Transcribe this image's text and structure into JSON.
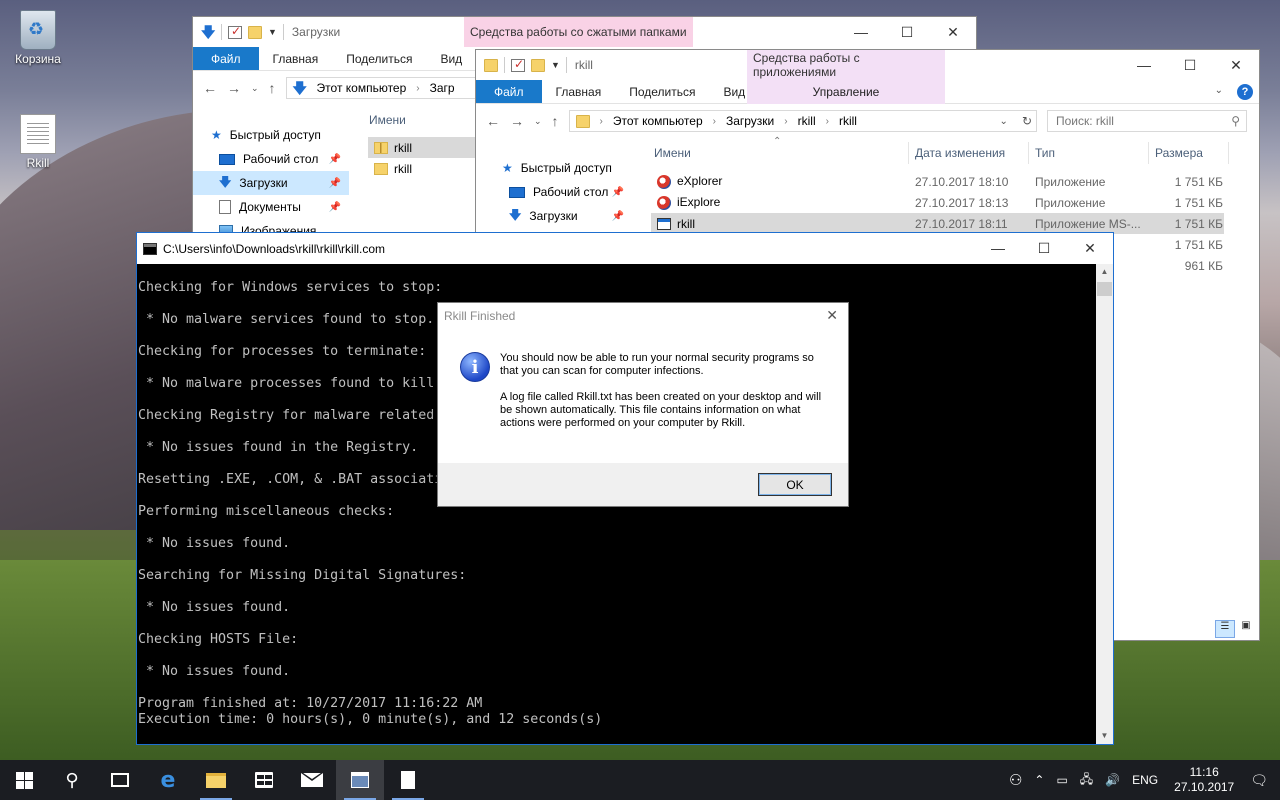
{
  "desktop": {
    "icons": [
      {
        "label": "Корзина",
        "icon": "recycle-bin-icon"
      },
      {
        "label": "Rkill",
        "icon": "text-file-icon"
      }
    ]
  },
  "explorer_back": {
    "title": "Загрузки",
    "context_tab": "Средства работы со сжатыми папками",
    "context_tab_color": "#f9d2e6",
    "tabs": [
      "Файл",
      "Главная",
      "Поделиться",
      "Вид"
    ],
    "path": [
      "Этот компьютер",
      "Загр"
    ],
    "nav": [
      "Быстрый доступ",
      "Рабочий стол",
      "Загрузки",
      "Документы",
      "Изображения"
    ],
    "column": "Имени",
    "files": [
      "rkill",
      "rkill"
    ]
  },
  "explorer_front": {
    "title": "rkill",
    "context_tab": "Средства работы с приложениями",
    "context_tab_color": "#f3e0f6",
    "context_sub": "Управление",
    "tabs": [
      "Файл",
      "Главная",
      "Поделиться",
      "Вид"
    ],
    "path": [
      "Этот компьютер",
      "Загрузки",
      "rkill",
      "rkill"
    ],
    "search_placeholder": "Поиск: rkill",
    "nav": [
      "Быстрый доступ",
      "Рабочий стол",
      "Загрузки"
    ],
    "columns": [
      "Имени",
      "Дата изменения",
      "Тип",
      "Размера"
    ],
    "files": [
      {
        "name": "eXplorer",
        "date": "27.10.2017 18:10",
        "type": "Приложение",
        "size": "1 751 КБ"
      },
      {
        "name": "iExplore",
        "date": "27.10.2017 18:13",
        "type": "Приложение",
        "size": "1 751 КБ"
      },
      {
        "name": "rkill",
        "date": "27.10.2017 18:11",
        "type": "Приложение MS-...",
        "size": "1 751 КБ"
      },
      {
        "name": "",
        "date": "",
        "type": "",
        "size": "1 751 КБ"
      },
      {
        "name": "",
        "date": "",
        "type": "MS-...",
        "size": "961 КБ"
      }
    ]
  },
  "console": {
    "title": "C:\\Users\\info\\Downloads\\rkill\\rkill\\rkill.com",
    "lines": [
      "Checking for Windows services to stop:",
      "",
      " * No malware services found to stop.",
      "",
      "Checking for processes to terminate:",
      "",
      " * No malware processes found to kill.",
      "",
      "Checking Registry for malware related settings:",
      "",
      " * No issues found in the Registry.",
      "",
      "Resetting .EXE, .COM, & .BAT associations in the Windows Registry.",
      "",
      "Performing miscellaneous checks:",
      "",
      " * No issues found.",
      "",
      "Searching for Missing Digital Signatures:",
      "",
      " * No issues found.",
      "",
      "Checking HOSTS File:",
      "",
      " * No issues found.",
      "",
      "Program finished at: 10/27/2017 11:16:22 AM",
      "Execution time: 0 hours(s), 0 minute(s), and 12 seconds(s)"
    ]
  },
  "dialog": {
    "title": "Rkill Finished",
    "para1": "You should now be able to run your normal security programs so that you can scan for computer infections.",
    "para2": "A log file called Rkill.txt has been created on your desktop and will be shown automatically.  This file contains information on what actions were performed on your computer by Rkill.",
    "ok": "OK"
  },
  "taskbar": {
    "lang": "ENG",
    "time": "11:16",
    "date": "27.10.2017"
  }
}
